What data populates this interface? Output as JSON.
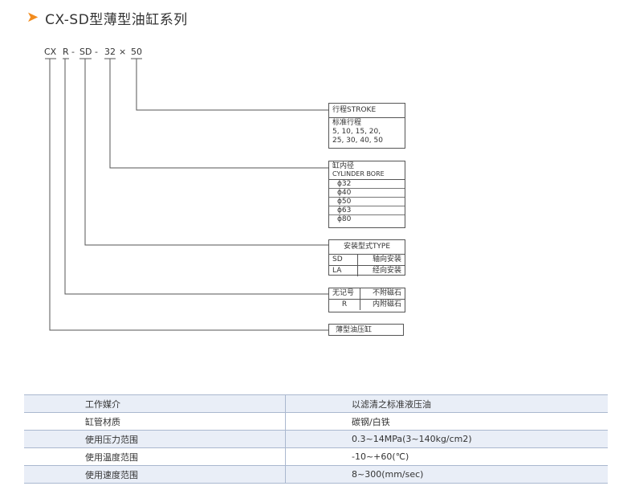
{
  "title": "CX-SD型薄型油缸系列",
  "model_code": {
    "parts": [
      "CX",
      "R",
      "-",
      "SD",
      "-",
      "32",
      "×",
      "50"
    ]
  },
  "stroke_box": {
    "header": "行程STROKE",
    "label": "标准行程",
    "line1": "5, 10, 15, 20,",
    "line2": "25, 30, 40, 50"
  },
  "bore_box": {
    "header1": "缸内径",
    "header2": "CYLINDER BORE",
    "values": [
      "ϕ32",
      "ϕ40",
      "ϕ50",
      "ϕ63",
      "ϕ80"
    ]
  },
  "mount_box": {
    "header": "安装型式TYPE",
    "rows": [
      {
        "code": "SD",
        "desc": "轴向安装"
      },
      {
        "code": "LA",
        "desc": "经向安装"
      }
    ]
  },
  "magnet_box": {
    "rows": [
      {
        "code": "无记号",
        "desc": "不附磁石"
      },
      {
        "code": "R",
        "desc": "内附磁石"
      }
    ]
  },
  "type_box": {
    "label": "薄型油压缸"
  },
  "spec_table": [
    {
      "key": "工作媒介",
      "value": "以滤清之标准液压油"
    },
    {
      "key": "缸管材质",
      "value": "碳钢/白铁"
    },
    {
      "key": "使用压力范围",
      "value": "0.3~14MPa(3~140kg/cm2)"
    },
    {
      "key": "使用温度范围",
      "value": "-10~+60(℃)"
    },
    {
      "key": "使用速度范围",
      "value": "8~300(mm/sec)"
    }
  ]
}
